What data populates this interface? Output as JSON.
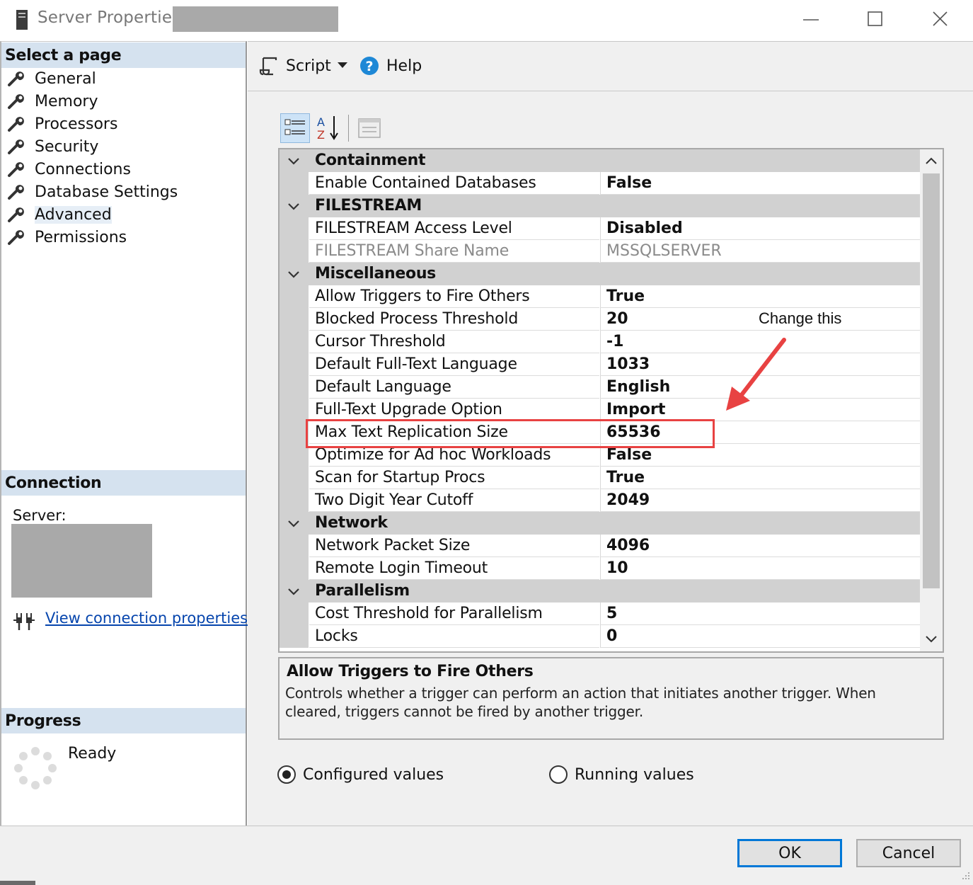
{
  "window": {
    "title": "Server Properties - "
  },
  "left": {
    "select_page_header": "Select a page",
    "pages": [
      {
        "label": "General"
      },
      {
        "label": "Memory"
      },
      {
        "label": "Processors"
      },
      {
        "label": "Security"
      },
      {
        "label": "Connections"
      },
      {
        "label": "Database Settings"
      },
      {
        "label": "Advanced",
        "selected": true
      },
      {
        "label": "Permissions"
      }
    ],
    "connection_header": "Connection",
    "server_label": "Server:",
    "view_connection_link": "View connection properties",
    "progress_header": "Progress",
    "progress_status": "Ready"
  },
  "toolbar": {
    "script_label": "Script",
    "help_label": "Help"
  },
  "grid": {
    "categories": [
      {
        "name": "Containment",
        "props": [
          {
            "name": "Enable Contained Databases",
            "value": "False"
          }
        ]
      },
      {
        "name": "FILESTREAM",
        "props": [
          {
            "name": "FILESTREAM Access Level",
            "value": "Disabled"
          },
          {
            "name": "FILESTREAM Share Name",
            "value": "MSSQLSERVER",
            "readonly": true
          }
        ]
      },
      {
        "name": "Miscellaneous",
        "props": [
          {
            "name": "Allow Triggers to Fire Others",
            "value": "True"
          },
          {
            "name": "Blocked Process Threshold",
            "value": "20"
          },
          {
            "name": "Cursor Threshold",
            "value": "-1"
          },
          {
            "name": "Default Full-Text Language",
            "value": "1033"
          },
          {
            "name": "Default Language",
            "value": "English"
          },
          {
            "name": "Full-Text Upgrade Option",
            "value": "Import"
          },
          {
            "name": "Max Text Replication Size",
            "value": "65536"
          },
          {
            "name": "Optimize for Ad hoc Workloads",
            "value": "False"
          },
          {
            "name": "Scan for Startup Procs",
            "value": "True"
          },
          {
            "name": "Two Digit Year Cutoff",
            "value": "2049"
          }
        ]
      },
      {
        "name": "Network",
        "props": [
          {
            "name": "Network Packet Size",
            "value": "4096"
          },
          {
            "name": "Remote Login Timeout",
            "value": "10"
          }
        ]
      },
      {
        "name": "Parallelism",
        "props": [
          {
            "name": "Cost Threshold for Parallelism",
            "value": "5"
          },
          {
            "name": "Locks",
            "value": "0"
          }
        ]
      }
    ]
  },
  "description": {
    "title": "Allow Triggers to Fire Others",
    "text": "Controls whether a trigger can perform an action that initiates another trigger. When cleared, triggers cannot be fired by another trigger."
  },
  "radios": {
    "configured_label": "Configured values",
    "running_label": "Running values",
    "selected": "configured"
  },
  "buttons": {
    "ok_label": "OK",
    "cancel_label": "Cancel"
  },
  "annotation": {
    "text": "Change this",
    "color": "#e84242"
  }
}
